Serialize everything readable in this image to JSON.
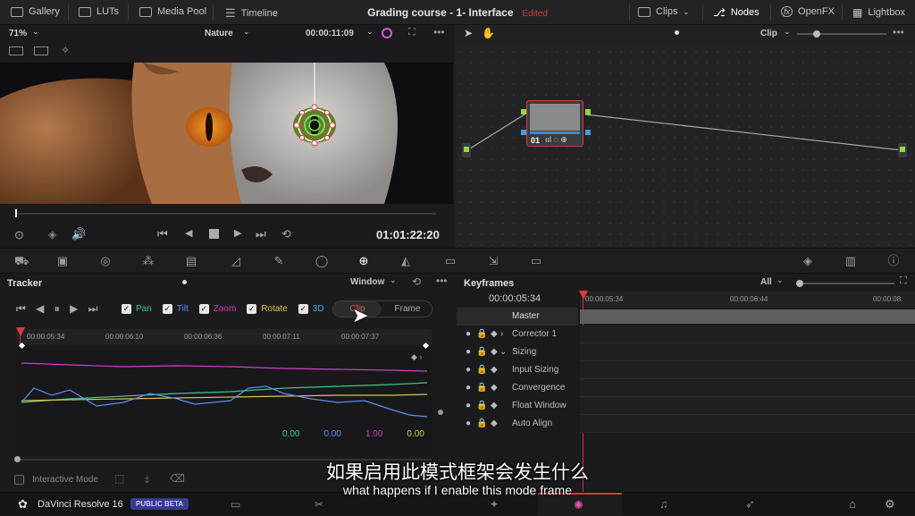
{
  "topbar": {
    "gallery": "Gallery",
    "luts": "LUTs",
    "media_pool": "Media Pool",
    "timeline": "Timeline",
    "project_title": "Grading course - 1- Interface",
    "edited": "Edited",
    "clips": "Clips",
    "nodes": "Nodes",
    "openfx": "OpenFX",
    "lightbox": "Lightbox"
  },
  "viewer": {
    "zoom": "71%",
    "clip_name": "Nature",
    "source_timecode": "00:00:11:09",
    "record_timecode": "01:01:22:20"
  },
  "node_editor": {
    "mode": "Clip",
    "node_label": "01"
  },
  "tracker": {
    "title": "Tracker",
    "window_select": "Window",
    "checks": [
      {
        "label": "Pan",
        "color": "#3fc48a"
      },
      {
        "label": "Tilt",
        "color": "#5b8ef0"
      },
      {
        "label": "Zoom",
        "color": "#d23fc4"
      },
      {
        "label": "Rotate",
        "color": "#d9c24a"
      },
      {
        "label": "3D",
        "color": "#3fb3d9"
      }
    ],
    "clip_button": "Clip",
    "frame_button": "Frame",
    "ruler": [
      "00:00:05:34",
      "00:00:06:10",
      "00:00:06:36",
      "00:00:07:11",
      "00:00:07:37"
    ],
    "values": [
      {
        "value": "0.00",
        "color": "#3fc48a"
      },
      {
        "value": "0.00",
        "color": "#5b8ef0"
      },
      {
        "value": "1.00",
        "color": "#d23fc4"
      },
      {
        "value": "0.00",
        "color": "#d9c24a"
      }
    ],
    "interactive_mode": "Interactive Mode"
  },
  "keyframes": {
    "title": "Keyframes",
    "filter": "All",
    "timecode": "00:00:05:34",
    "ruler": [
      "00:00:05:34",
      "00:00:06:44",
      "00:00:08:"
    ],
    "master": "Master",
    "rows": [
      "Corrector 1",
      "Sizing",
      "Input Sizing",
      "Convergence",
      "Float Window",
      "Auto Align"
    ]
  },
  "bottombar": {
    "app_name": "DaVinci Resolve 16",
    "badge": "PUBLIC BETA"
  },
  "subtitles": {
    "chinese": "如果启用此模式框架会发生什么",
    "english": "what happens if I enable this mode frame"
  }
}
